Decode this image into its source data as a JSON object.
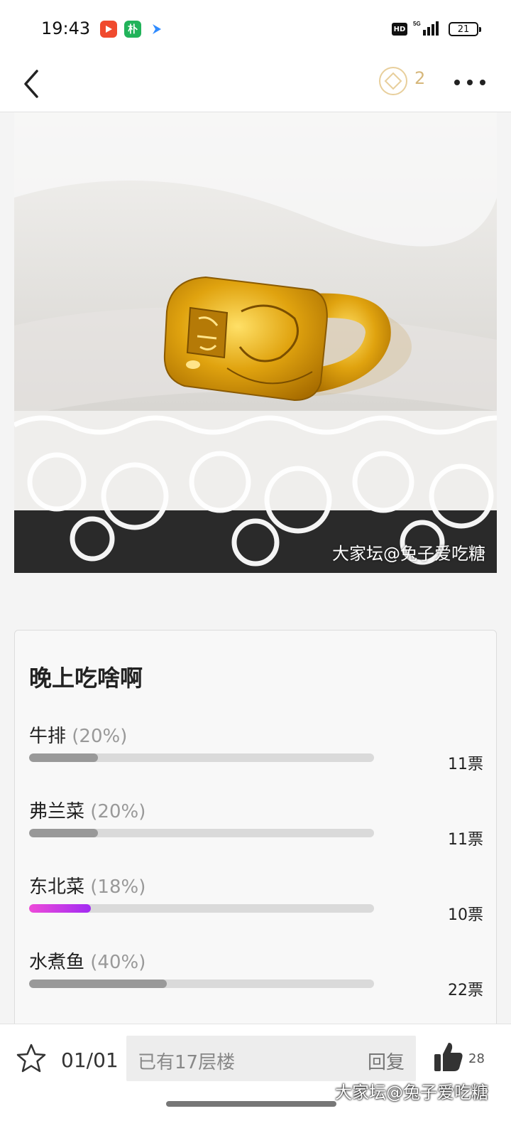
{
  "status_bar": {
    "time": "19:43",
    "apps": [
      "video-app-icon",
      "pinduoduo-icon",
      "arrow-app-icon"
    ],
    "hd": "HD",
    "network": "5G",
    "battery": "21"
  },
  "nav": {
    "coin_count": "2"
  },
  "post": {
    "image_watermark": "大家坛@兔子爱吃糖"
  },
  "poll": {
    "title": "晚上吃啥啊",
    "options": [
      {
        "label": "牛排",
        "percent_text": "(20%)",
        "percent": 20,
        "votes": "11票",
        "accent": false
      },
      {
        "label": "弗兰菜",
        "percent_text": "(20%)",
        "percent": 20,
        "votes": "11票",
        "accent": false
      },
      {
        "label": "东北菜",
        "percent_text": "(18%)",
        "percent": 18,
        "votes": "10票",
        "accent": true
      },
      {
        "label": "水煮鱼",
        "percent_text": "(40%)",
        "percent": 40,
        "votes": "22票",
        "accent": false
      }
    ]
  },
  "bottom_bar": {
    "page_indicator": "01/01",
    "reply_placeholder": "已有17层楼",
    "reply_action": "回复",
    "like_count": "28",
    "watermark": "大家坛@兔子爱吃糖"
  },
  "colors": {
    "coin": "#d6b77b",
    "accent_bar_start": "#ee4bd9",
    "accent_bar_end": "#a22bf2"
  }
}
